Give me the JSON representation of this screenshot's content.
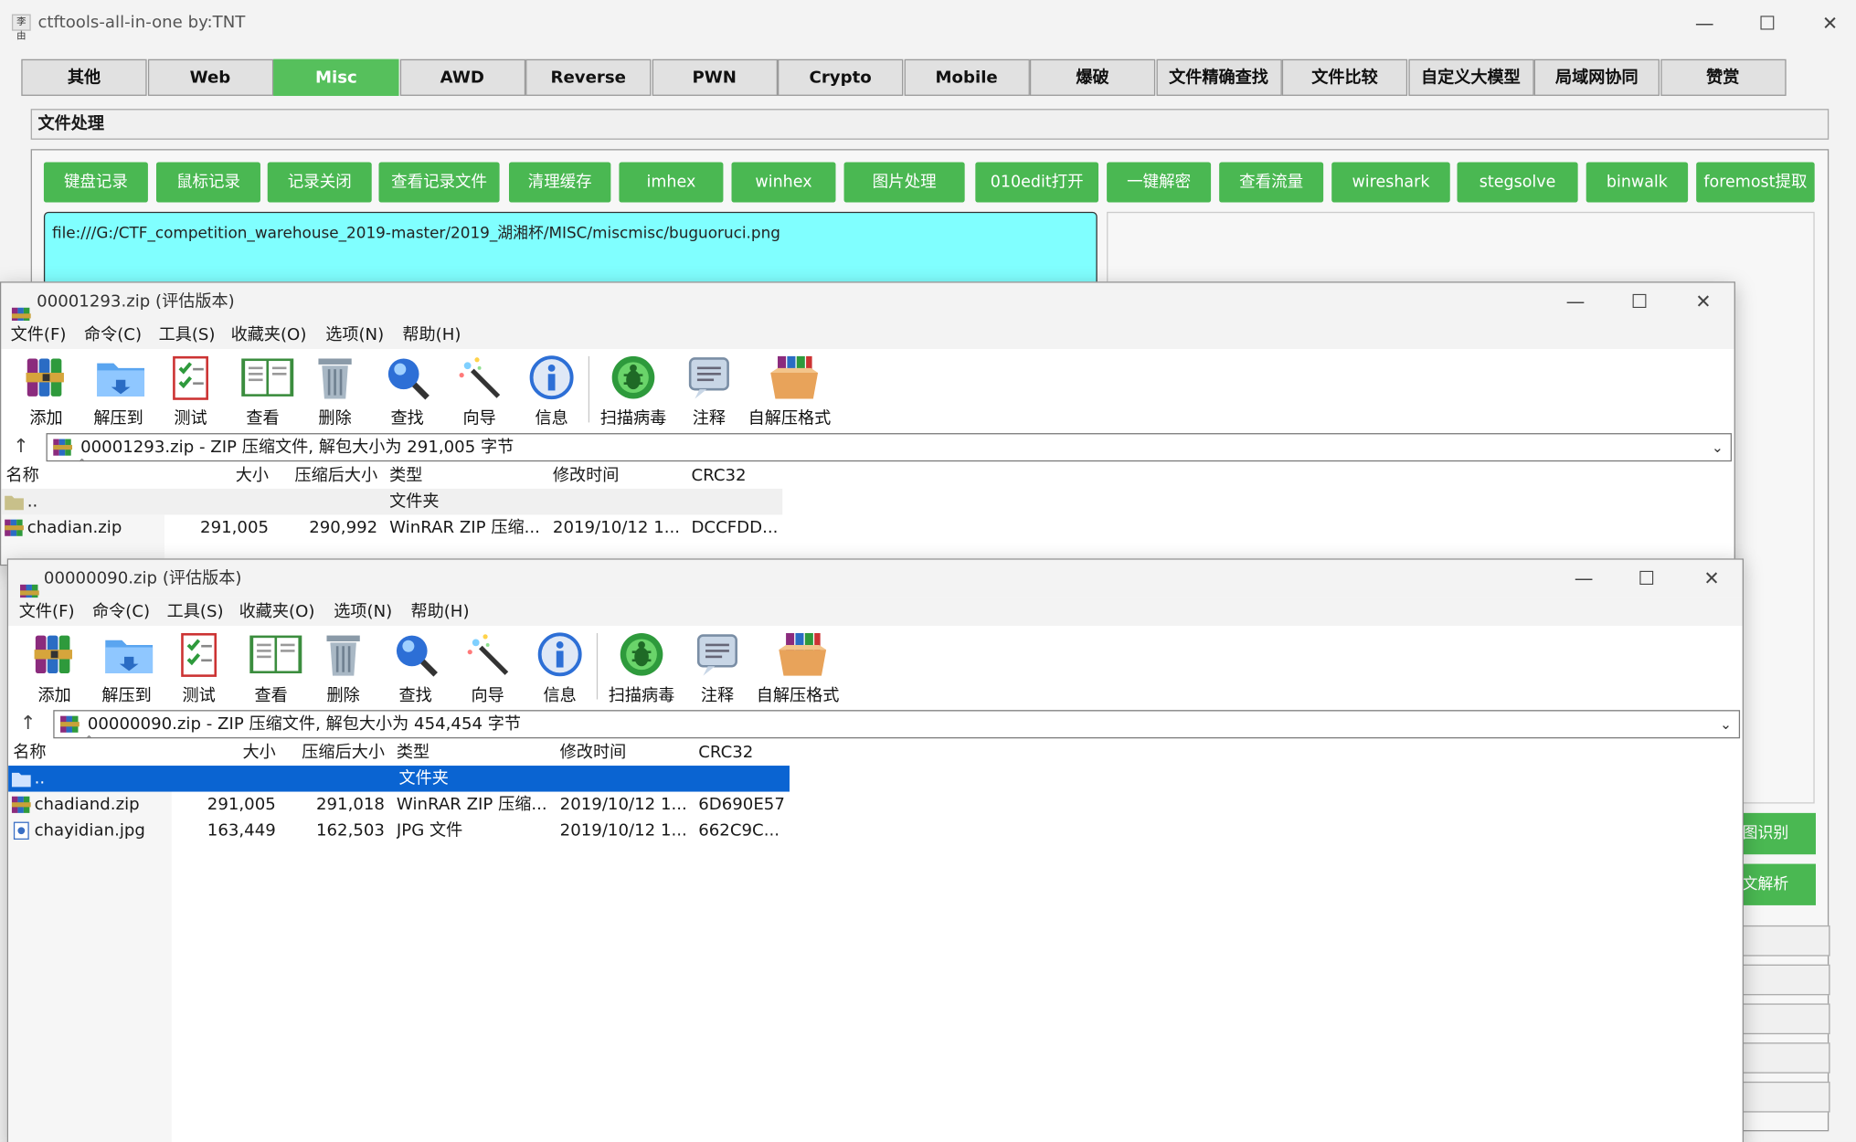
{
  "app": {
    "title": "ctftools-all-in-one   by:TNT",
    "logo_text": "李由",
    "window_controls": {
      "minimize": "—",
      "maximize": "☐",
      "close": "✕"
    },
    "tabs": [
      "其他",
      "Web",
      "Misc",
      "AWD",
      "Reverse",
      "PWN",
      "Crypto",
      "Mobile",
      "爆破",
      "文件精确查找",
      "文件比较",
      "自定义大模型",
      "局域网协同",
      "赞赏"
    ],
    "active_tab": "Misc",
    "section_title": "文件处理",
    "buttons": [
      "键盘记录",
      "鼠标记录",
      "记录关闭",
      "查看记录文件",
      "清理缓存",
      "imhex",
      "winhex",
      "图片处理",
      "010edit打开",
      "一键解密",
      "查看流量",
      "wireshark",
      "stegsolve",
      "binwalk",
      "foremost提取"
    ],
    "file_path": "file:///G:/CTF_competition_warehouse_2019-master/2019_湖湘杯/MISC/miscmisc/buguoruci.png",
    "right_buttons": [
      "图识别",
      "文解析"
    ],
    "accent_color": "#4ab852",
    "input_color": "#80ffff"
  },
  "winrar1": {
    "title": "00001293.zip (评估版本)",
    "menu": [
      "文件(F)",
      "命令(C)",
      "工具(S)",
      "收藏夹(O)",
      "选项(N)",
      "帮助(H)"
    ],
    "tools": [
      "添加",
      "解压到",
      "测试",
      "查看",
      "删除",
      "查找",
      "向导",
      "信息",
      "扫描病毒",
      "注释",
      "自解压格式"
    ],
    "address": "00001293.zip - ZIP 压缩文件, 解包大小为 291,005 字节",
    "columns": [
      "名称",
      "大小",
      "压缩后大小",
      "类型",
      "修改时间",
      "CRC32"
    ],
    "rows": [
      {
        "name": "..",
        "size": "",
        "packed": "",
        "type": "文件夹",
        "modified": "",
        "crc": ""
      },
      {
        "name": "chadian.zip",
        "size": "291,005",
        "packed": "290,992",
        "type": "WinRAR ZIP 压缩...",
        "modified": "2019/10/12 1...",
        "crc": "DCCFDD..."
      }
    ]
  },
  "winrar2": {
    "title": "00000090.zip (评估版本)",
    "menu": [
      "文件(F)",
      "命令(C)",
      "工具(S)",
      "收藏夹(O)",
      "选项(N)",
      "帮助(H)"
    ],
    "tools": [
      "添加",
      "解压到",
      "测试",
      "查看",
      "删除",
      "查找",
      "向导",
      "信息",
      "扫描病毒",
      "注释",
      "自解压格式"
    ],
    "address": "00000090.zip - ZIP 压缩文件, 解包大小为 454,454 字节",
    "columns": [
      "名称",
      "大小",
      "压缩后大小",
      "类型",
      "修改时间",
      "CRC32"
    ],
    "rows": [
      {
        "name": "..",
        "size": "",
        "packed": "",
        "type": "文件夹",
        "modified": "",
        "crc": ""
      },
      {
        "name": "chadiand.zip",
        "size": "291,005",
        "packed": "291,018",
        "type": "WinRAR ZIP 压缩...",
        "modified": "2019/10/12 1...",
        "crc": "6D690E57"
      },
      {
        "name": "chayidian.jpg",
        "size": "163,449",
        "packed": "162,503",
        "type": "JPG 文件",
        "modified": "2019/10/12 1...",
        "crc": "662C9C..."
      }
    ],
    "selected_row": 0,
    "selection_color": "#0a64d2"
  },
  "icons": {
    "add": "books-stack-icon",
    "extract": "folder-icon",
    "test": "checklist-icon",
    "view": "open-book-icon",
    "delete": "trash-can-icon",
    "find": "magnifier-icon",
    "wizard": "magic-wand-icon",
    "info": "info-icon",
    "virus": "bug-scan-icon",
    "comment": "note-icon",
    "sfx": "box-icon",
    "up": "arrow-up-icon",
    "dropdown": "chevron-down-icon"
  }
}
